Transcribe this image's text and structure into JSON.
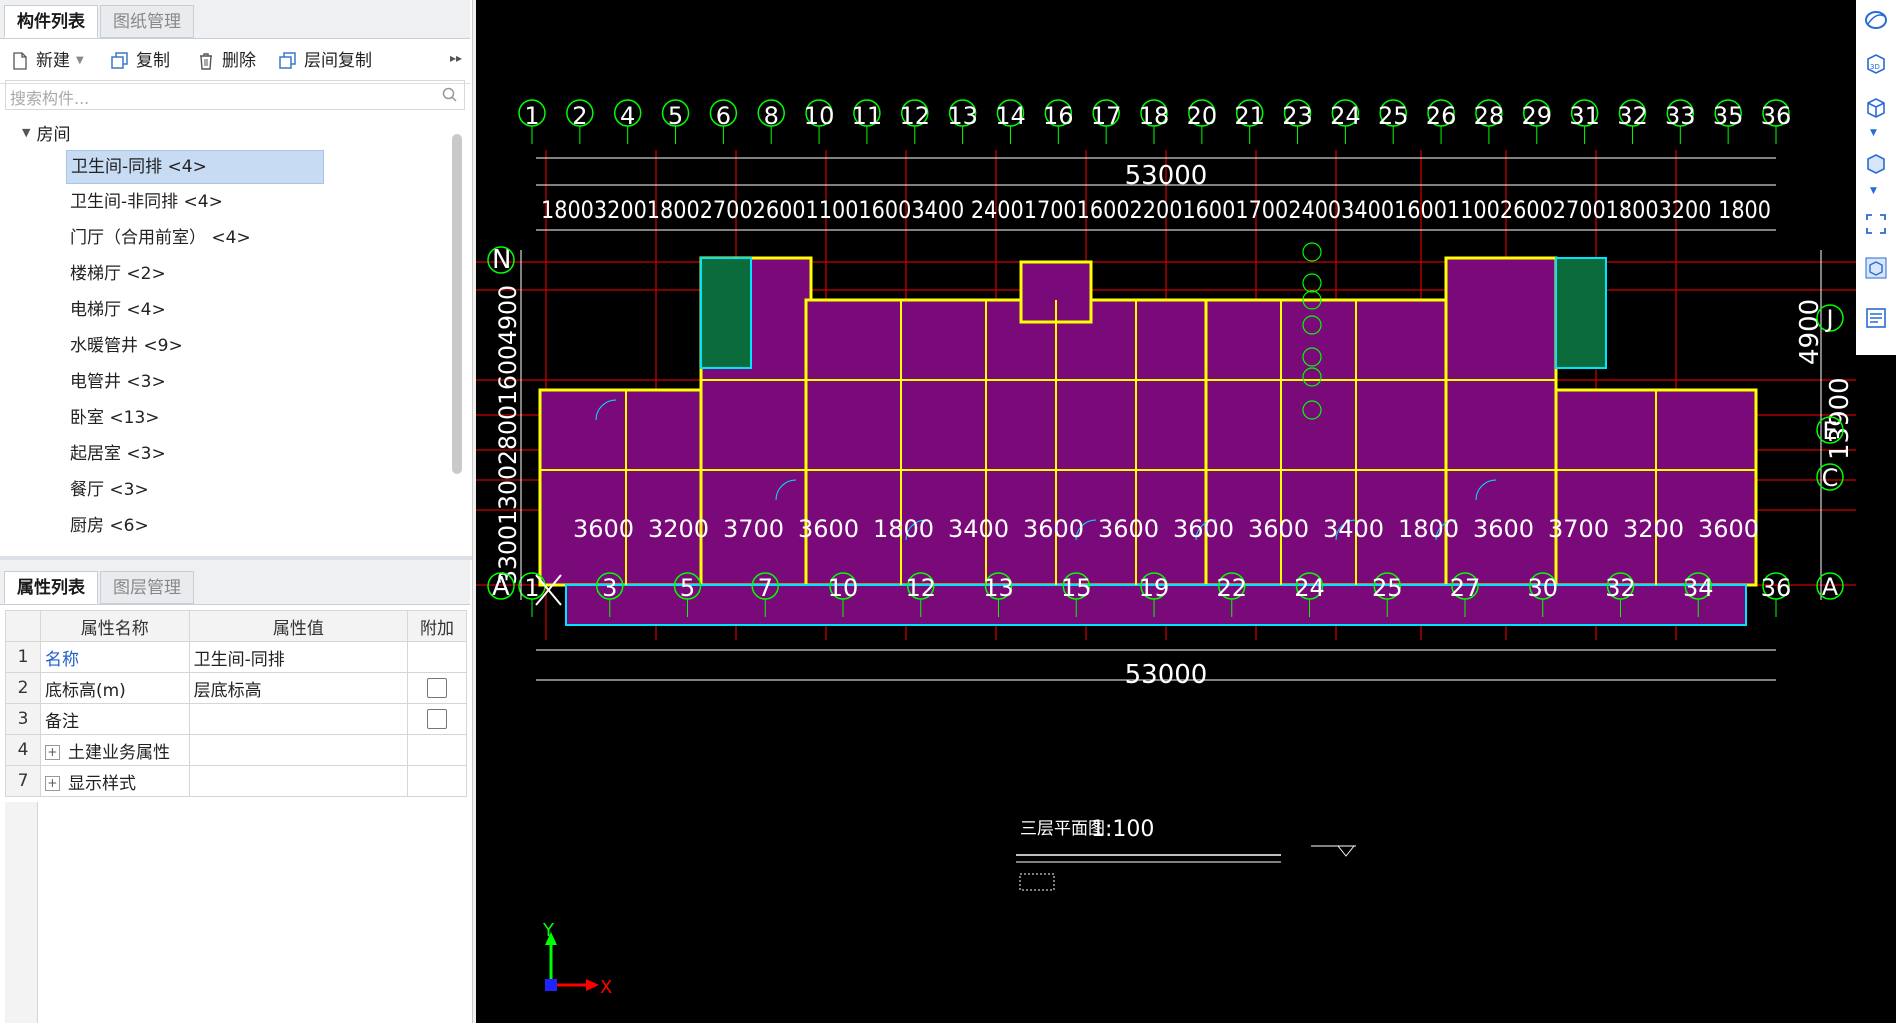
{
  "left_panel": {
    "tabs": [
      "构件列表",
      "图纸管理"
    ],
    "toolbar": {
      "new_label": "新建",
      "copy_label": "复制",
      "delete_label": "删除",
      "floor_copy_label": "层间复制"
    },
    "search_placeholder": "搜索构件...",
    "tree": {
      "root_label": "房间",
      "items": [
        "卫生间-同排 <4>",
        "卫生间-非同排 <4>",
        "门厅（合用前室） <4>",
        "楼梯厅 <2>",
        "电梯厅 <4>",
        "水暖管井 <9>",
        "电管井 <3>",
        "卧室 <13>",
        "起居室 <3>",
        "餐厅 <3>",
        "厨房 <6>"
      ]
    }
  },
  "properties_panel": {
    "tabs": [
      "属性列表",
      "图层管理"
    ],
    "headers": [
      "属性名称",
      "属性值",
      "附加"
    ],
    "rows": [
      {
        "idx": "1",
        "name": "名称",
        "value": "卫生间-同排"
      },
      {
        "idx": "2",
        "name": "底标高(m)",
        "value": "层底标高"
      },
      {
        "idx": "3",
        "name": "备注",
        "value": ""
      },
      {
        "idx": "4",
        "name": "土建业务属性",
        "value": ""
      },
      {
        "idx": "7",
        "name": "显示样式",
        "value": ""
      }
    ]
  },
  "drawing": {
    "top_axes": [
      "1",
      "2",
      "4",
      "5",
      "6",
      "8",
      "10",
      "11",
      "12",
      "13",
      "14",
      "16",
      "17",
      "18",
      "20",
      "21",
      "23",
      "24",
      "25",
      "26",
      "28",
      "29",
      "31",
      "32",
      "33",
      "35",
      "36"
    ],
    "top_total": "53000",
    "top_dims_text": "18003200180027002600110016003400 24001700160022001600170024003400160011002600270018003200 1800",
    "bottom_dims": [
      "3600",
      "3200",
      "3700",
      "3600",
      "1800",
      "3400",
      "3600",
      "3600",
      "3600",
      "3600",
      "3400",
      "1800",
      "3600",
      "3700",
      "3200",
      "3600"
    ],
    "bottom_total": "53000",
    "bottom_axes": [
      "1",
      "3",
      "5",
      "7",
      "10",
      "12",
      "13",
      "15",
      "19",
      "22",
      "24",
      "25",
      "27",
      "30",
      "32",
      "34",
      "36"
    ],
    "left_axes": [
      "N",
      "A"
    ],
    "left_dims": "33001300280016004900",
    "right_axes": [
      "J",
      "E",
      "C",
      "A"
    ],
    "right_dims": [
      "4900",
      "13900"
    ],
    "plan_title": "三层平面图",
    "plan_scale": "1:100",
    "coord_x_label": "X",
    "coord_y_label": "Y",
    "colors": {
      "background": "#000000",
      "room_fill": "#7a0a7a",
      "axis": "#00ff00",
      "wall": "#ffff00",
      "grid_red": "#ff0000",
      "cyan": "#00e5ff"
    }
  },
  "right_toolbar": {
    "icons": [
      "orbit-icon",
      "3d-view-icon",
      "cube-icon",
      "cube-blue-icon",
      "fullscreen-icon",
      "layer-cube-icon",
      "property-sheet-icon"
    ]
  }
}
